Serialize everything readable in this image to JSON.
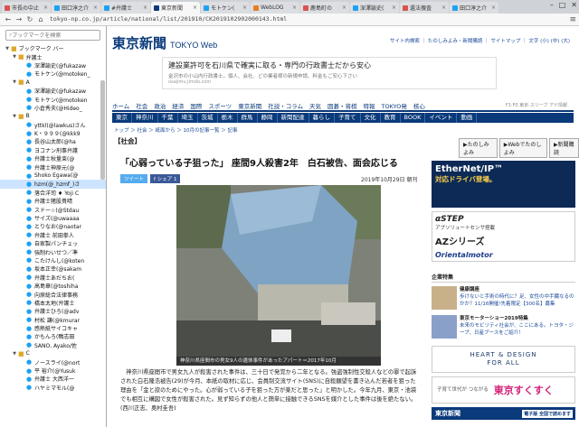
{
  "tabs": [
    {
      "label": "市長の中止",
      "color": "#d9534f",
      "active": false
    },
    {
      "label": "田口淳之介",
      "color": "#1da1f2",
      "active": false
    },
    {
      "label": "#弁護士",
      "color": "#1da1f2",
      "active": false
    },
    {
      "label": "東京新聞",
      "color": "#0a3a7a",
      "active": true
    },
    {
      "label": "モトケン(",
      "color": "#1da1f2",
      "active": false
    },
    {
      "label": "WebLOG",
      "color": "#e67e22",
      "active": false
    },
    {
      "label": "鹿島町の",
      "color": "#d9534f",
      "active": false
    },
    {
      "label": "深澤諭史(",
      "color": "#1da1f2",
      "active": false
    },
    {
      "label": "遺法捜査",
      "color": "#d9534f",
      "active": false
    },
    {
      "label": "田口淳之介",
      "color": "#1da1f2",
      "active": false
    }
  ],
  "window": {
    "min": "–",
    "max": "□",
    "close": "✕"
  },
  "nav": {
    "back": "←",
    "forward": "→",
    "reload": "↻",
    "home": "⌂",
    "url": "tokyo-np.co.jp/article/national/list/201910/CK2019102902000143.html",
    "menu": "≡"
  },
  "sidebar": {
    "placeholder": "ブックマークを検索",
    "items": [
      {
        "label": "ブックマーク バー",
        "type": "folder",
        "level": 0,
        "arrow": "▼"
      },
      {
        "label": "弁護士",
        "type": "folder",
        "level": 1,
        "arrow": "▼"
      },
      {
        "label": "深澤諭史(@fukazaw",
        "type": "tw",
        "level": 2
      },
      {
        "label": "モトケン(@motoken_",
        "type": "tw",
        "level": 2
      },
      {
        "label": "A",
        "type": "folder",
        "level": 1,
        "arrow": "▼"
      },
      {
        "label": "深澤諭史(@fukazaw",
        "type": "tw",
        "level": 2
      },
      {
        "label": "モトケン(@motoken",
        "type": "tw",
        "level": 2
      },
      {
        "label": "小倉秀夫(@Hideo_",
        "type": "tw",
        "level": 2
      },
      {
        "label": "B",
        "type": "folder",
        "level": 1,
        "arrow": "▼"
      },
      {
        "label": "yttkl(@lawkus)さん",
        "type": "tw",
        "level": 2
      },
      {
        "label": "K・９９９(@kkk9",
        "type": "tw",
        "level": 2
      },
      {
        "label": "長谷山太郎(@ha",
        "type": "tw",
        "level": 2
      },
      {
        "label": "ヨコナン刑事弁護",
        "type": "tw",
        "level": 2
      },
      {
        "label": "弁護士秋量束(@",
        "type": "tw",
        "level": 2
      },
      {
        "label": "弁護士神原元(@",
        "type": "tw",
        "level": 2
      },
      {
        "label": "Shoko Egawa(@",
        "type": "tw",
        "level": 2
      },
      {
        "label": "hzm(@_hzmf_)さ",
        "type": "tw",
        "level": 2,
        "selected": true
      },
      {
        "label": "落合洋司 ♦ Yoji C",
        "type": "tw",
        "level": 2
      },
      {
        "label": "弁護士猪股貴晴",
        "type": "tw",
        "level": 2
      },
      {
        "label": "スドー☆(@Stdau",
        "type": "tw",
        "level": 2
      },
      {
        "label": "サイズ(@uwaaaa",
        "type": "tw",
        "level": 2
      },
      {
        "label": "とりなお(@naotar",
        "type": "tw",
        "level": 2
      },
      {
        "label": "弁護士 前田拳人",
        "type": "tw",
        "level": 2
      },
      {
        "label": "自家製パンチェッ",
        "type": "tw",
        "level": 2
      },
      {
        "label": "強制わいせつ／準",
        "type": "tw",
        "level": 2
      },
      {
        "label": "こたけんし(@koten",
        "type": "tw",
        "level": 2
      },
      {
        "label": "坂本正幸(@sakam",
        "type": "tw",
        "level": 2
      },
      {
        "label": "弁護士あだちお(",
        "type": "tw",
        "level": 2
      },
      {
        "label": "高島章(@toshiha",
        "type": "tw",
        "level": 2
      },
      {
        "label": "向原総合法律事務",
        "type": "tw",
        "level": 2
      },
      {
        "label": "橋本太地(弁護士",
        "type": "tw",
        "level": 2
      },
      {
        "label": "弁護士ひろ(@adv",
        "type": "tw",
        "level": 2
      },
      {
        "label": "村松 謙(@kmurar",
        "type": "tw",
        "level": 2
      },
      {
        "label": "感熱紙サイコキャ",
        "type": "tw",
        "level": 2
      },
      {
        "label": "かもんろ(鴨志田",
        "type": "tw",
        "level": 2
      },
      {
        "label": "SANO, Ayako/佐",
        "type": "tw",
        "level": 2
      },
      {
        "label": "C",
        "type": "folder",
        "level": 1,
        "arrow": "▼"
      },
      {
        "label": "ノースライ(@nort",
        "type": "tw",
        "level": 2
      },
      {
        "label": "平 裕介(@Yusuk",
        "type": "tw",
        "level": 2
      },
      {
        "label": "弁護士 大西洋一",
        "type": "tw",
        "level": 2
      },
      {
        "label": "ハヤミマモル(@",
        "type": "tw",
        "level": 2
      }
    ]
  },
  "site": {
    "logo": "東京新聞",
    "logo_sub": "TOKYO Web",
    "toplinks": "サイト内検索 ｜ たのしみよみ・新聞購読 ｜ サイトマップ ｜ 文字 (小) (中) (大)",
    "ad": {
      "headline": "建設業許可を石川県で確実に取る・専門の行政書士だから安心",
      "sub": "金沢市の小山内行政書士。個人、会社、どの業者様の新規申請、料金もご安心下さい",
      "url": "osajimu.jimdo.com"
    },
    "nav1": [
      "ホーム",
      "社会",
      "政治",
      "経済",
      "国際",
      "スポーツ",
      "東京新聞",
      "社説・コラム",
      "天気",
      "囲碁・将棋",
      "特報",
      "TOKYO発",
      "核心"
    ],
    "nav1_right": "F1·F0 東京·スリーブ アド情報",
    "nav2": [
      "東京",
      "神奈川",
      "千葉",
      "埼玉",
      "茨城",
      "栃木",
      "群馬",
      "静岡",
      "新聞配達",
      "暮らし",
      "子育て",
      "文化",
      "教育",
      "BOOK",
      "イベント",
      "動画"
    ],
    "breadcrumb": "トップ ＞ 社会 ＞ 紙面から ＞ 10月の記事一覧 ＞ 記事",
    "section": "【社会】",
    "right_tabs": [
      "▶たのしみよみ",
      "▶Webでたのしよみ",
      "▶新聞購読"
    ]
  },
  "article": {
    "headline": "「心弱っている子狙った」 座間9人殺害2年　白石被告、面会応じる",
    "tweet": "ツイート",
    "fb": "f シェア 1",
    "date": "2019年10月29日 朝刊",
    "caption": "神奈川県座間市の男女9人の遺体事件があったアパート＝2017年10月",
    "body": "神奈川県座間市で男女九人が殺害された事件は、三十日で発覚から二年となる。強盗強制性交殺人などの罪で起訴された白石隆浩被告(29)が今月、本紙の取材に応じ、会員制交流サイト(SNS)に自殺願望を書き込んだ若者を狙った理由を「金と欲のためにやった。心が弱っている子を狙った方が楽だと思った」と明かした。今年九月、東京・池袋でも相互に構図で女性が殺害された。見ず知らずの他人と簡単に接触できるSNSを媒介とした事件は後を絶たない。　(西川正志、奥村圭吾)"
  },
  "right": {
    "ad1_a": "EtherNet/IP™",
    "ad1_b": "対応ドライバ登場。",
    "ad2_a": "αSTEP",
    "ad2_b": "アブソリュートセンサ搭載",
    "ad2_c": "AZシリーズ",
    "ad2_d": "Orientalmotor",
    "kigyo": "企業特集",
    "kr": [
      {
        "title": "健康講座",
        "text": "歩けないと手術の時代に？足、女性の中手臓なるのかか？11/16開催!先着限定【300名】募集"
      },
      {
        "title": "東京モーターショー2019特集",
        "text": "未来のモビリティ社会が、ここにある。トヨタ・ジープ、日産ブースをご紹介！"
      }
    ],
    "heart_a": "HEART & DESIGN",
    "heart_b": "FOR ALL",
    "kos_a": "子育て世代が つながる",
    "kos_b": "東京すくすく",
    "tokyo_btm": "東京新聞",
    "tokyo_btm_badge": "電子版 全国で読めます"
  }
}
